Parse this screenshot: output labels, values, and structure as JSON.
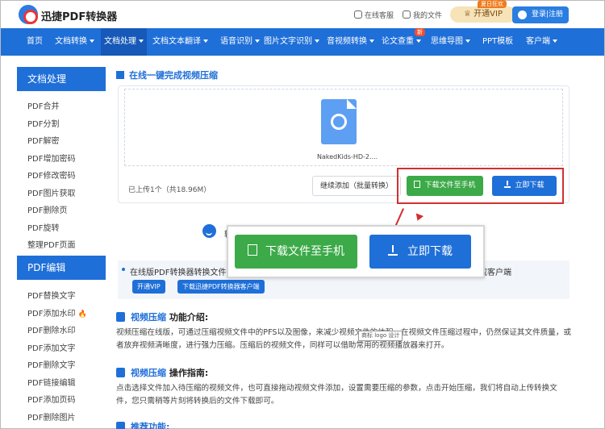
{
  "header": {
    "brand": "迅捷PDF转换器",
    "service_label": "在线客服",
    "files_label": "我的文件",
    "vip_label": "开通VIP",
    "vip_tag": "夏日狂欢",
    "login_label": "登录|注册"
  },
  "nav": {
    "items": [
      {
        "label": "首页",
        "dropdown": false
      },
      {
        "label": "文档转换",
        "dropdown": true
      },
      {
        "label": "文档处理",
        "dropdown": true,
        "active": true
      },
      {
        "label": "文档文本翻译",
        "dropdown": true
      },
      {
        "label": "语音识别",
        "dropdown": true
      },
      {
        "label": "图片文字识别",
        "dropdown": true
      },
      {
        "label": "音视频转换",
        "dropdown": true
      },
      {
        "label": "论文查重",
        "dropdown": true
      },
      {
        "label": "思维导图",
        "dropdown": true
      },
      {
        "label": "PPT模板",
        "dropdown": false
      },
      {
        "label": "客户端",
        "dropdown": true
      }
    ],
    "new_badge": "新"
  },
  "sidebar": {
    "group1_title": "文档处理",
    "group1_items": [
      "PDF合并",
      "PDF分割",
      "PDF解密",
      "PDF增加密码",
      "PDF修改密码",
      "PDF图片获取",
      "PDF删除页",
      "PDF旋转",
      "整理PDF页面"
    ],
    "group2_title": "PDF编辑",
    "group2_items": [
      "PDF替换文字",
      "PDF添加水印",
      "PDF删除水印",
      "PDF添加文字",
      "PDF删除文字",
      "PDF链接编辑",
      "PDF添加页码",
      "PDF删除图片"
    ]
  },
  "main": {
    "section_title": "在线一键完成视频压缩",
    "file_name": "NakedKids-HD-2....",
    "uploaded_text": "已上传1个（共18.96M）",
    "add_button": "继续添加（批量转换）",
    "phone_button": "下载文件至手机",
    "download_button": "立即下载",
    "side_char": "转",
    "info_text": "在线版PDF转换器转换文件仅",
    "info_tail": "载客户端",
    "pill_vip": "开通VIP",
    "pill_client": "下载迅捷PDF转换器客户端",
    "intro_heading_blue": "视频压缩",
    "intro_heading_rest": " 功能介绍:",
    "intro_para": "视频压缩在线版，可通过压缩视频文件中的PFS以及图像，来减少视频文件的体积，在视频文件压缩过程中，仍然保证其文件质量，或者放弃视频清晰度，进行强力压缩。压缩后的视频文件，同样可以借助常用的视频播放器来打开。",
    "tooltip": "商标 logo 设计",
    "guide_heading_blue": "视频压缩",
    "guide_heading_rest": " 操作指南:",
    "guide_para": "点击选择文件加入待压缩的视频文件，也可直接拖动视频文件添加，设置需要压缩的参数，点击开始压缩，我们将自动上传转换文件，您只需稍等片刻将转换后的文件下载即可。",
    "recommend_heading": "推荐功能:"
  },
  "colors": {
    "primary": "#1f6fd8",
    "green": "#3caa48",
    "highlight_red": "#d32f2f"
  }
}
